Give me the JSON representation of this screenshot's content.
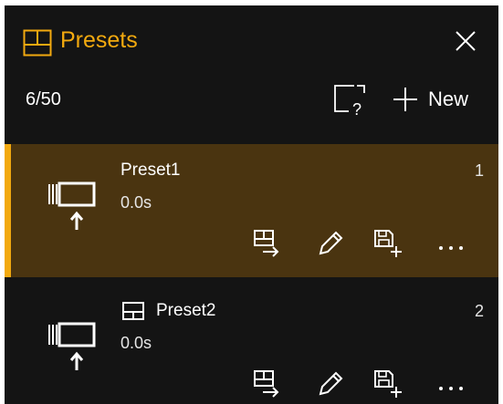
{
  "header": {
    "title": "Presets",
    "icon": "layout-grid-icon",
    "close_icon": "close-icon"
  },
  "toolbar": {
    "count": "6/50",
    "help_icon": "help-frame-icon",
    "new_label": "New",
    "new_icon": "plus-icon"
  },
  "presets": [
    {
      "name": "Preset1",
      "duration": "0.0s",
      "number": "1",
      "selected": true,
      "has_layout_icon": false
    },
    {
      "name": "Preset2",
      "duration": "0.0s",
      "number": "2",
      "selected": false,
      "has_layout_icon": true
    }
  ],
  "actions": [
    "apply-icon",
    "edit-icon",
    "save-icon",
    "more-icon"
  ],
  "colors": {
    "accent": "#f2a90f",
    "selected_bg": "#4a3410",
    "panel_bg": "#141414",
    "text": "#ffffff"
  }
}
